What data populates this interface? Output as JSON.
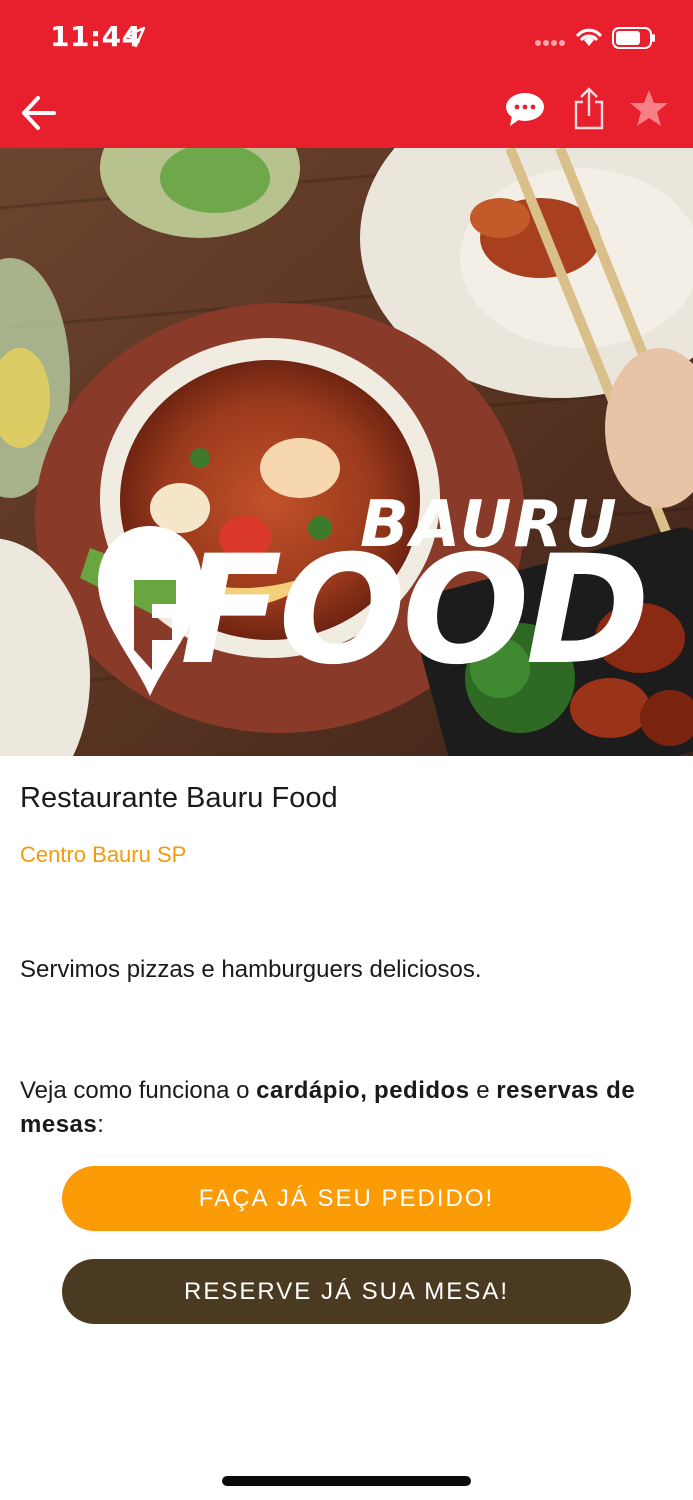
{
  "status_bar": {
    "time": "11:44",
    "icons": [
      "location-arrow-icon",
      "cellular-signal-icon",
      "wifi-icon",
      "battery-icon"
    ]
  },
  "nav_bar": {
    "icons": [
      "back-arrow-icon",
      "chat-bubble-icon",
      "share-icon",
      "star-icon"
    ],
    "color": "#e81f2d"
  },
  "hero": {
    "brand_top": "BAURU",
    "brand_main": "FOOD"
  },
  "restaurant": {
    "name": "Restaurante Bauru Food",
    "location": "Centro Bauru SP",
    "description": "Servimos pizzas e hamburguers deliciosos.",
    "howto": {
      "prefix": "Veja como funciona o ",
      "bold1": "cardápio,",
      "sep1": " ",
      "bold2": "pedidos",
      "sep2": " e ",
      "bold3": "reservas de mesas",
      "suffix": ":"
    }
  },
  "actions": {
    "order_label": "FAÇA JÁ SEU PEDIDO!",
    "reserve_label": "RESERVE JÁ SUA MESA!"
  },
  "colors": {
    "accent_orange": "#fb9b06",
    "location_orange": "#f59a0c",
    "reserve_brown": "#4a3a22"
  }
}
